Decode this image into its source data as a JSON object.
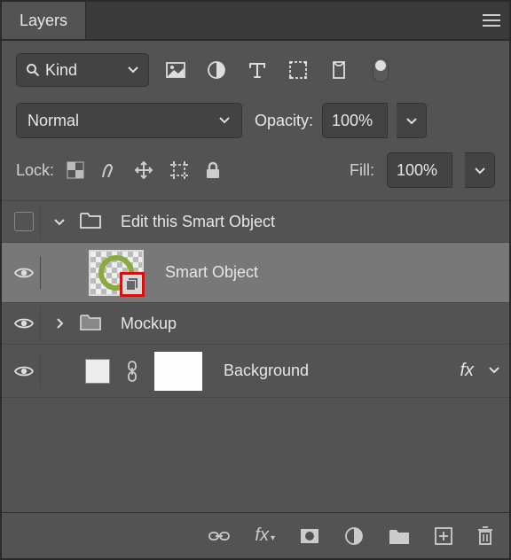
{
  "panel": {
    "title": "Layers"
  },
  "filter": {
    "kind_label": "Kind"
  },
  "blend": {
    "mode": "Normal",
    "opacity_label": "Opacity:",
    "opacity_value": "100%"
  },
  "lock": {
    "label": "Lock:",
    "fill_label": "Fill:",
    "fill_value": "100%"
  },
  "layers": {
    "group1": {
      "name": "Edit this Smart Object"
    },
    "smart_object": {
      "name": "Smart Object"
    },
    "group2": {
      "name": "Mockup"
    },
    "background": {
      "name": "Background",
      "fx": "fx"
    }
  }
}
